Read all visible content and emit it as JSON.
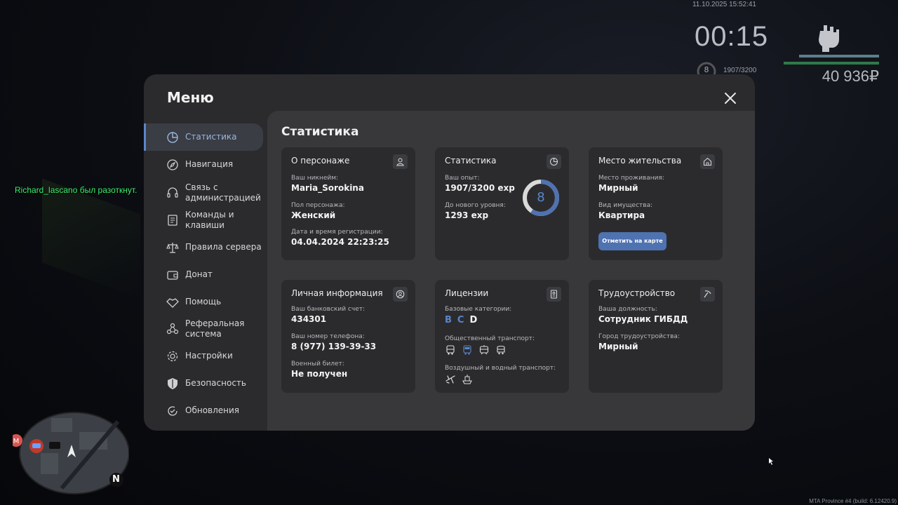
{
  "hud": {
    "datetime": "11.10.2025 15:52:41",
    "timer": "00:15",
    "level": "8",
    "exp": "1907/3200",
    "money": "40 936₽",
    "chat_message": "Richard_lascano был разоткнут.",
    "build": "MTA Province #4 (build: 6.12420.9)",
    "minimap_compass": "N"
  },
  "menu": {
    "title": "Меню",
    "sidebar": [
      {
        "label": "Статистика",
        "icon": "pie-chart-icon",
        "active": true
      },
      {
        "label": "Навигация",
        "icon": "compass-icon"
      },
      {
        "label": "Связь с администрацией",
        "icon": "headset-icon"
      },
      {
        "label": "Команды и клавиши",
        "icon": "document-icon"
      },
      {
        "label": "Правила сервера",
        "icon": "scales-icon"
      },
      {
        "label": "Донат",
        "icon": "wallet-icon"
      },
      {
        "label": "Помощь",
        "icon": "handshake-icon"
      },
      {
        "label": "Реферальная система",
        "icon": "network-icon"
      },
      {
        "label": "Настройки",
        "icon": "gear-icon"
      },
      {
        "label": "Безопасность",
        "icon": "shield-icon"
      },
      {
        "label": "Обновления",
        "icon": "refresh-icon"
      }
    ],
    "content_title": "Статистика",
    "cards": {
      "character": {
        "title": "О персонаже",
        "nickname_label": "Ваш никнейм:",
        "nickname": "Maria_Sorokina",
        "gender_label": "Пол персонажа:",
        "gender": "Женский",
        "reg_label": "Дата и время регистрации:",
        "reg_date": "04.04.2024 22:23:25"
      },
      "stats": {
        "title": "Статистика",
        "exp_label": "Ваш опыт:",
        "exp": "1907/3200 exp",
        "next_label": "До нового уровня:",
        "next": "1293 exp",
        "level": "8",
        "progress": 0.596
      },
      "residence": {
        "title": "Место жительства",
        "place_label": "Место проживания:",
        "place": "Мирный",
        "type_label": "Вид имущества:",
        "type": "Квартира",
        "button": "Отметить на карте"
      },
      "personal": {
        "title": "Личная информация",
        "bank_label": "Ваш банковский счет:",
        "bank": "434301",
        "phone_label": "Ваш номер телефона:",
        "phone": "8 (977) 139-39-33",
        "military_label": "Военный билет:",
        "military": "Не получен"
      },
      "licenses": {
        "title": "Лицензии",
        "base_label": "Базовые категории:",
        "base": [
          {
            "letter": "B",
            "color": "#5a86c9"
          },
          {
            "letter": "C",
            "color": "#5a86c9"
          },
          {
            "letter": "D",
            "color": "#f4f4f4"
          }
        ],
        "public_label": "Общественный транспорт:",
        "public_icons": [
          "bus-icon",
          "trolleybus-icon",
          "tram-icon",
          "minibus-icon"
        ],
        "air_label": "Воздушный и водный транспорт:",
        "air_icons": [
          "airplane-icon",
          "boat-icon"
        ]
      },
      "job": {
        "title": "Трудоустройство",
        "position_label": "Ваша должность:",
        "position": "Сотрудник ГИБДД",
        "city_label": "Город трудоустройства:",
        "city": "Мирный"
      }
    }
  },
  "colors": {
    "accent": "#5a86c9",
    "button": "#4f72b0",
    "chat": "#3cf06a"
  }
}
